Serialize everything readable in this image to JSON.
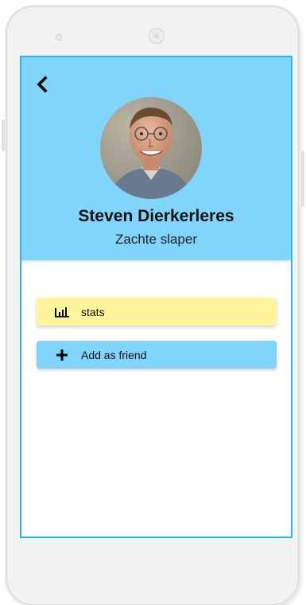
{
  "profile": {
    "name": "Steven Dierkerleres",
    "subtitle": "Zachte slaper"
  },
  "actions": {
    "stats_label": "stats",
    "add_friend_label": "Add as friend"
  },
  "icons": {
    "back": "chevron-left-icon",
    "stats": "bar-chart-icon",
    "add_friend": "plus-icon"
  },
  "colors": {
    "header": "#81d4fa",
    "stats_button": "#fff59d",
    "friend_button": "#81d4fa",
    "screen_border": "#29b6e6"
  }
}
